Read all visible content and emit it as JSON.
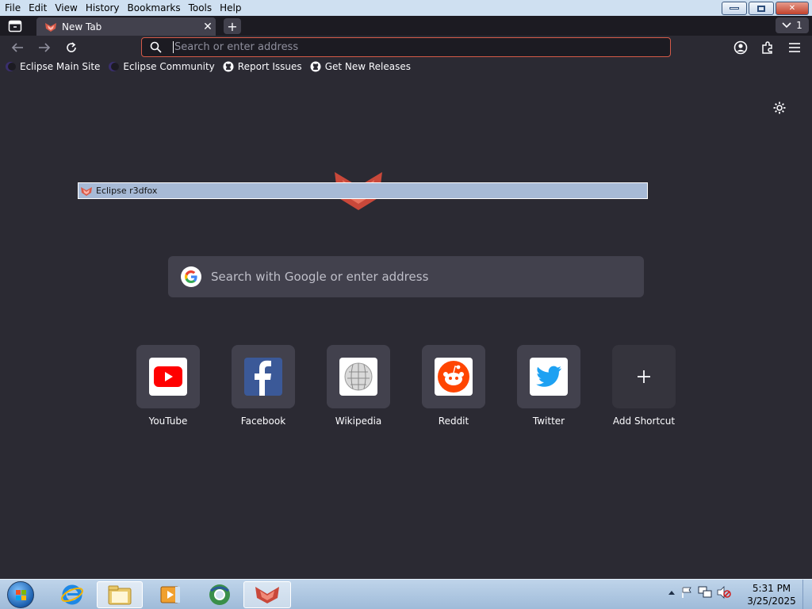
{
  "menubar": {
    "items": [
      "File",
      "Edit",
      "View",
      "History",
      "Bookmarks",
      "Tools",
      "Help"
    ]
  },
  "tabs": {
    "active_title": "New Tab",
    "count": "1"
  },
  "urlbar": {
    "placeholder": "Search or enter address"
  },
  "bookmarks": [
    {
      "label": "Eclipse Main Site",
      "icon": "eclipse-icon"
    },
    {
      "label": "Eclipse Community",
      "icon": "eclipse-icon"
    },
    {
      "label": "Report Issues",
      "icon": "github-icon"
    },
    {
      "label": "Get New Releases",
      "icon": "github-icon"
    }
  ],
  "tooltip": {
    "text": "Eclipse r3dfox"
  },
  "search": {
    "placeholder": "Search with Google or enter address"
  },
  "shortcuts": [
    {
      "label": "YouTube",
      "icon": "youtube-icon"
    },
    {
      "label": "Facebook",
      "icon": "facebook-icon"
    },
    {
      "label": "Wikipedia",
      "icon": "wikipedia-icon"
    },
    {
      "label": "Reddit",
      "icon": "reddit-icon"
    },
    {
      "label": "Twitter",
      "icon": "twitter-icon"
    },
    {
      "label": "Add Shortcut",
      "icon": "plus-icon"
    }
  ],
  "clock": {
    "time": "5:31 PM",
    "date": "3/25/2025"
  },
  "colors": {
    "accent": "#d45a48",
    "background": "#2b2a33",
    "tile": "#42414d"
  }
}
